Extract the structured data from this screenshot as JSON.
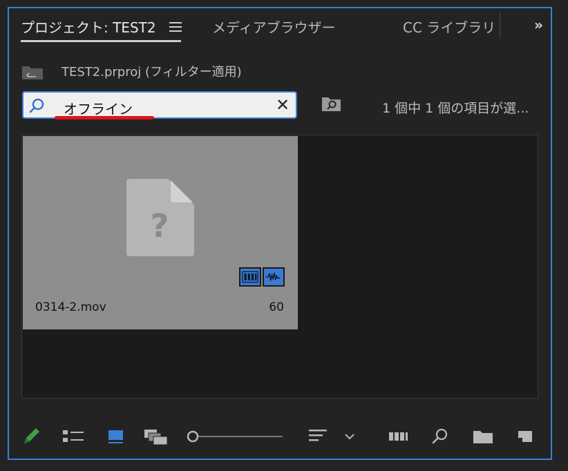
{
  "tabs": {
    "project": "プロジェクト: TEST2",
    "media_browser": "メディアブラウザー",
    "cc_libraries": "CC ライブラリ",
    "overflow": "»"
  },
  "project": {
    "path": "TEST2.prproj (フィルター適用)"
  },
  "search": {
    "value": "オフライン",
    "clear_glyph": "✕"
  },
  "status": {
    "selection": "1 個中 1 個の項目が選..."
  },
  "clip": {
    "name": "0314-2.mov",
    "duration": "60",
    "icon": "missing-file-icon"
  },
  "colors": {
    "accent": "#3c7fd6",
    "annotation": "#e0141b",
    "pencil": "#3aa04a"
  }
}
